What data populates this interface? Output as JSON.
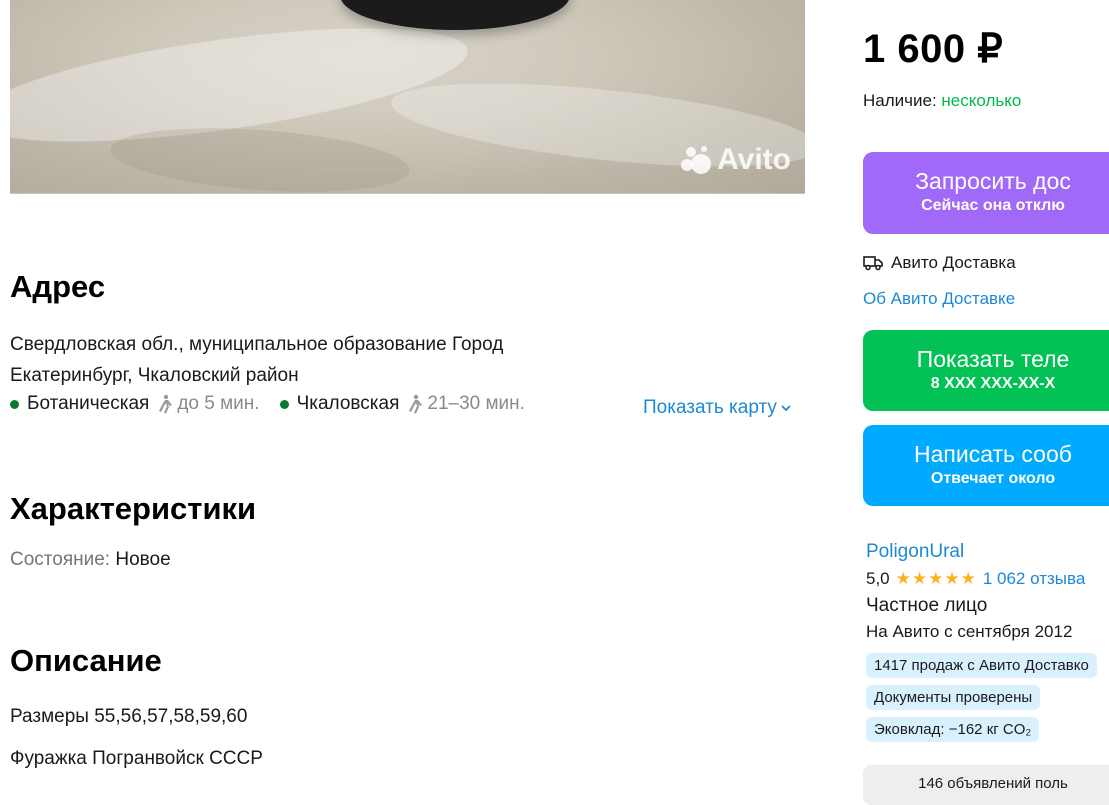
{
  "photo": {
    "watermark": "Avito"
  },
  "address": {
    "title": "Адрес",
    "line1": "Свердловская обл., муниципальное образование Город",
    "line2": "Екатеринбург, Чкаловский район",
    "metro": [
      {
        "station": "Ботаническая",
        "time": "до 5 мин."
      },
      {
        "station": "Чкаловская",
        "time": "21–30 мин."
      }
    ],
    "map_link": "Показать карту"
  },
  "characteristics": {
    "title": "Характеристики",
    "condition_label": "Состояние:",
    "condition_value": "Новое"
  },
  "description": {
    "title": "Описание",
    "line1": "Размеры 55,56,57,58,59,60",
    "line2": "Фуражка Погранвойск СССР"
  },
  "sidebar": {
    "price": "1 600 ₽",
    "availability_label": "Наличие:",
    "availability_value": "несколько",
    "request_button": {
      "title": "Запросить дос",
      "subtitle": "Сейчас она отклю"
    },
    "delivery_text": "Авито Доставка",
    "delivery_link": "Об Авито Доставке",
    "phone_button": {
      "title": "Показать теле",
      "subtitle": "8 XXX XXX-XX-X"
    },
    "message_button": {
      "title": "Написать сооб",
      "subtitle": "Отвечает около"
    },
    "colors": {
      "purple": "#a169f7",
      "green": "#02c255",
      "blue": "#00aaff",
      "link": "#1e88d6",
      "available": "#02b94a"
    }
  },
  "seller": {
    "name": "PoligonUral",
    "rating": "5,0",
    "stars": "★★★★★",
    "reviews": "1 062 отзыва",
    "type": "Частное лицо",
    "since": "На Авито с сентября 2012",
    "tags": [
      "1417 продаж с Авито Доставко",
      "Документы проверены",
      "Эковклад: −162 кг CO₂"
    ],
    "ads_count": "146 объявлений поль"
  }
}
